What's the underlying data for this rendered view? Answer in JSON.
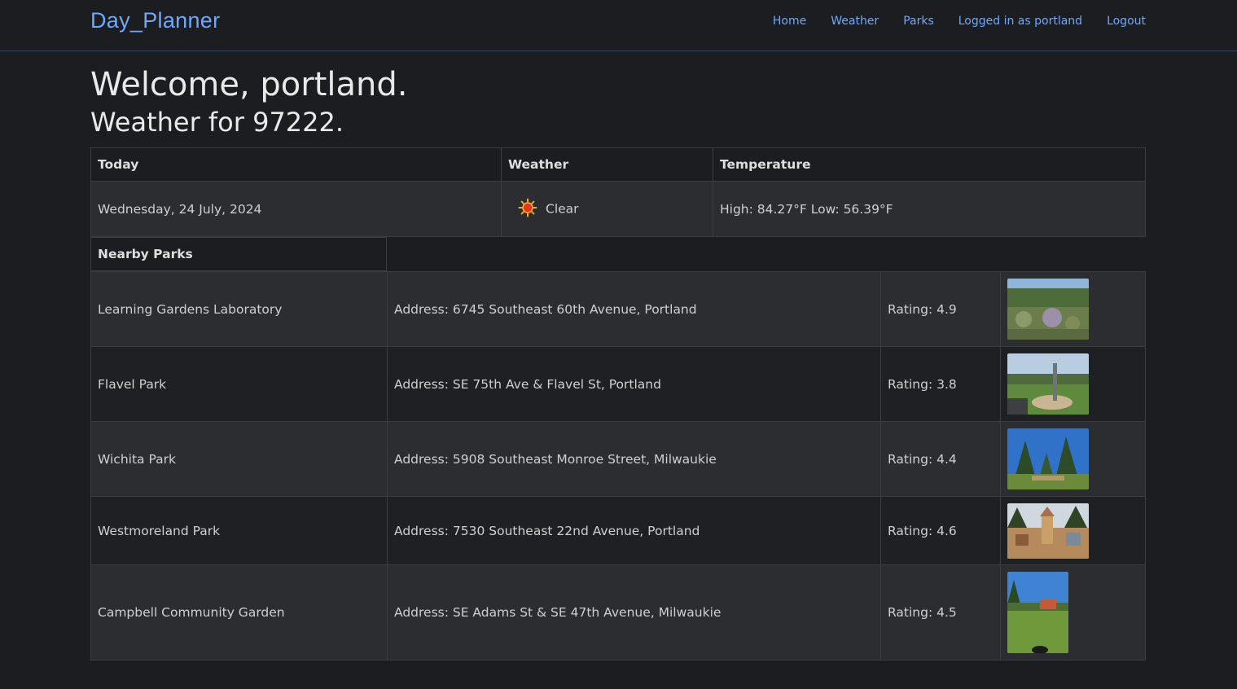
{
  "nav": {
    "brand": "Day_Planner",
    "links": [
      "Home",
      "Weather",
      "Parks",
      "Logged in as portland",
      "Logout"
    ]
  },
  "welcome": "Welcome, portland.",
  "weather_heading": "Weather for 97222.",
  "weather_table": {
    "headers": [
      "Today",
      "Weather",
      "Temperature"
    ],
    "date": "Wednesday, 24 July, 2024",
    "condition": "Clear",
    "condition_icon": "sun-icon",
    "temperature": "High: 84.27°F Low: 56.39°F"
  },
  "parks": {
    "heading": "Nearby Parks",
    "rows": [
      {
        "name": "Learning Gardens Laboratory",
        "address": "Address: 6745 Southeast 60th Avenue, Portland",
        "rating": "Rating: 4.9"
      },
      {
        "name": "Flavel Park",
        "address": "Address: SE 75th Ave & Flavel St, Portland",
        "rating": "Rating: 3.8"
      },
      {
        "name": "Wichita Park",
        "address": "Address: 5908 Southeast Monroe Street, Milwaukie",
        "rating": "Rating: 4.4"
      },
      {
        "name": "Westmoreland Park",
        "address": "Address: 7530 Southeast 22nd Avenue, Portland",
        "rating": "Rating: 4.6"
      },
      {
        "name": "Campbell Community Garden",
        "address": "Address: SE Adams St & SE 47th Avenue, Milwaukie",
        "rating": "Rating: 4.5"
      }
    ]
  },
  "colors": {
    "background": "#1c1d20",
    "link": "#6ea8fe",
    "row_fill": "#2b2d31"
  }
}
